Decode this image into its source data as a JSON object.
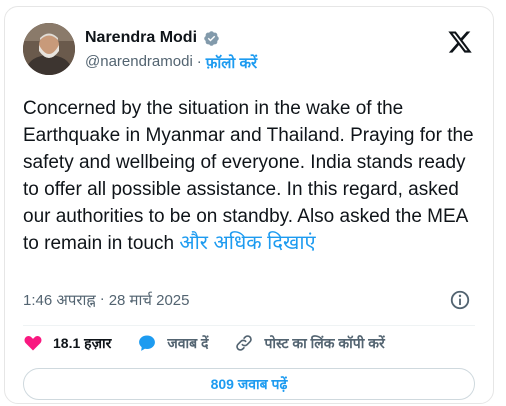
{
  "author": {
    "name": "Narendra Modi",
    "handle": "@narendramodi",
    "separator": "·",
    "follow_label": "फ़ॉलो करें"
  },
  "tweet": {
    "text": "Concerned by the situation in the wake of the Earthquake in Myanmar and Thailand. Praying for the safety and wellbeing of everyone. India stands ready to offer all possible assistance. In this regard, asked our authorities to be on standby. Also asked the MEA to remain in touch",
    "more_label": "और अधिक दिखाएं",
    "time": "1:46 अपराह्न",
    "dot": "·",
    "date": "28 मार्च 2025"
  },
  "actions": {
    "likes": "18.1 हज़ार",
    "reply": "जवाब दें",
    "copy_link": "पोस्ट का लिंक कॉपी करें"
  },
  "footer": {
    "read_replies": "809 जवाब पढ़ें"
  },
  "colors": {
    "accent": "#1d9bf0",
    "heart": "#f91880",
    "text": "#0f1419",
    "muted": "#536471"
  },
  "icons": [
    "verified-badge-icon",
    "x-logo-icon",
    "info-icon",
    "heart-icon",
    "reply-bubble-icon",
    "link-icon"
  ]
}
